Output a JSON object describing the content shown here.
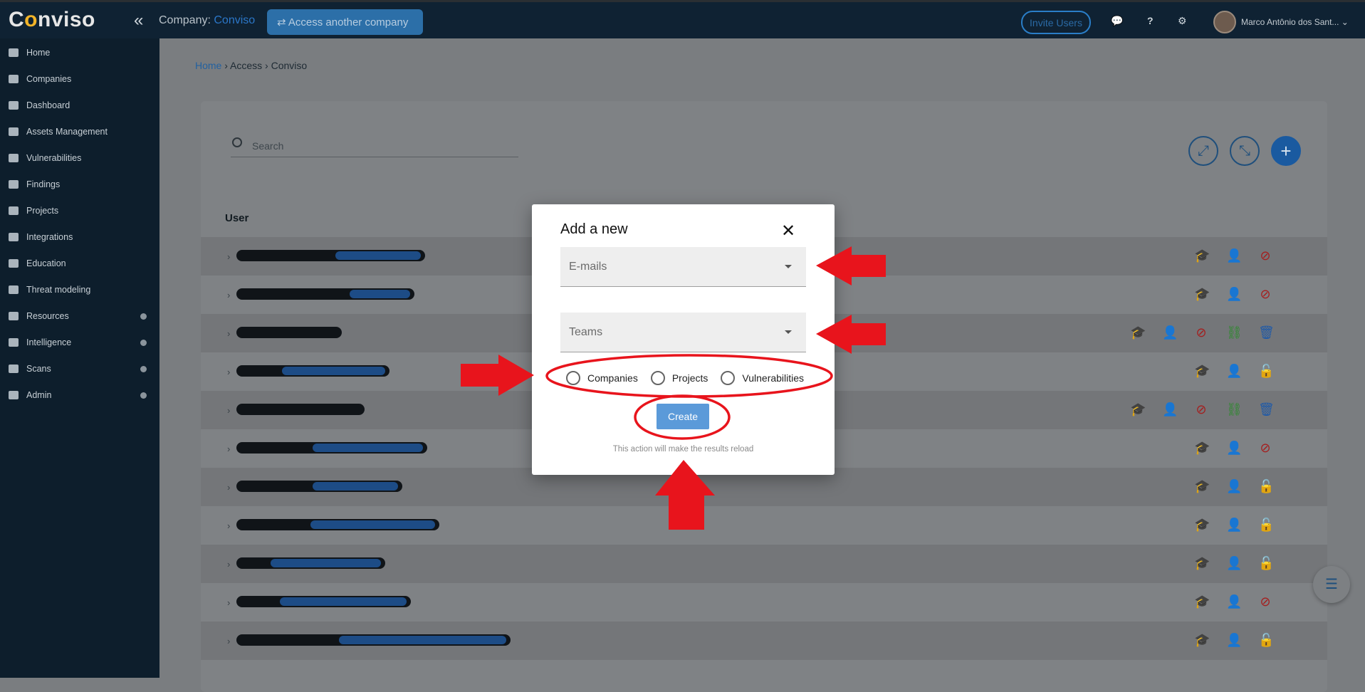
{
  "topbar": {
    "logo_pre": "C",
    "logo_o": "o",
    "logo_post": "nviso",
    "collapse_icon": "chevrons-left-icon",
    "company_prefix": "Company:",
    "company_name": "Conviso",
    "access_button": "⇄ Access another company",
    "invite_button": "Invite Users",
    "chat_icon": "chat-icon",
    "help_icon": "?",
    "settings_icon": "gear-icon",
    "user_name": "Marco Antônio dos Sant... ⌄"
  },
  "sidebar": {
    "items": [
      {
        "label": "Home",
        "icon": "home-icon"
      },
      {
        "label": "Companies",
        "icon": "building-icon"
      },
      {
        "label": "Dashboard",
        "icon": "gauge-icon"
      },
      {
        "label": "Assets Management",
        "icon": "server-icon"
      },
      {
        "label": "Vulnerabilities",
        "icon": "bug-icon"
      },
      {
        "label": "Findings",
        "icon": "flask-icon"
      },
      {
        "label": "Projects",
        "icon": "folder-icon"
      },
      {
        "label": "Integrations",
        "icon": "puzzle-icon"
      },
      {
        "label": "Education",
        "icon": "graduation-cap-icon"
      },
      {
        "label": "Threat modeling",
        "icon": "shield-icon"
      },
      {
        "label": "Resources",
        "icon": "wrench-icon",
        "has_submenu": true
      },
      {
        "label": "Intelligence",
        "icon": "lab-icon",
        "has_submenu": true
      },
      {
        "label": "Scans",
        "icon": "flask-icon",
        "has_submenu": true
      },
      {
        "label": "Admin",
        "icon": "briefcase-icon",
        "has_submenu": true
      }
    ]
  },
  "breadcrumb": {
    "home": "Home",
    "sep1": " › ",
    "access": "Access",
    "sep2": " › ",
    "current": "Conviso"
  },
  "search": {
    "placeholder": "Search"
  },
  "toolbar": {
    "expand_icon": "expand-icon",
    "collapse_icon": "compress-icon",
    "add_icon": "plus-icon"
  },
  "table": {
    "header": "User",
    "rows": [
      {
        "actions": [
          {
            "icon": "graduation-cap-icon",
            "color": "#a51e1e"
          },
          {
            "icon": "user-cog-icon",
            "color": "#2b8a2b"
          },
          {
            "icon": "ban-icon",
            "color": "#a51e1e"
          }
        ]
      },
      {
        "actions": [
          {
            "icon": "graduation-cap-icon",
            "color": "#a51e1e"
          },
          {
            "icon": "user-cog-icon",
            "color": "#2b8a2b"
          },
          {
            "icon": "ban-icon",
            "color": "#a51e1e"
          }
        ]
      },
      {
        "actions": [
          {
            "icon": "graduation-cap-icon",
            "color": "#1f5aa8"
          },
          {
            "icon": "user-cog-icon",
            "color": "#a51e1e"
          },
          {
            "icon": "ban-icon",
            "color": "#a51e1e"
          },
          {
            "icon": "link-icon",
            "color": "#2b8a2b"
          },
          {
            "icon": "trash-icon",
            "color": "#1f5aa8"
          }
        ]
      },
      {
        "actions": [
          {
            "icon": "graduation-cap-icon",
            "color": "#1f5aa8"
          },
          {
            "icon": "user-cog-icon",
            "color": "#2b8a2b"
          },
          {
            "icon": "lock-open-icon",
            "color": "#2b8a2b"
          }
        ]
      },
      {
        "actions": [
          {
            "icon": "graduation-cap-icon",
            "color": "#1f5aa8"
          },
          {
            "icon": "user-cog-icon",
            "color": "#a51e1e"
          },
          {
            "icon": "ban-icon",
            "color": "#a51e1e"
          },
          {
            "icon": "link-icon",
            "color": "#2b8a2b"
          },
          {
            "icon": "trash-icon",
            "color": "#1f5aa8"
          }
        ]
      },
      {
        "actions": [
          {
            "icon": "graduation-cap-icon",
            "color": "#a51e1e"
          },
          {
            "icon": "user-cog-icon",
            "color": "#2b8a2b"
          },
          {
            "icon": "ban-icon",
            "color": "#a51e1e"
          }
        ]
      },
      {
        "actions": [
          {
            "icon": "graduation-cap-icon",
            "color": "#1f5aa8"
          },
          {
            "icon": "user-cog-icon",
            "color": "#a51e1e"
          },
          {
            "icon": "lock-open-icon",
            "color": "#2b8a2b"
          }
        ]
      },
      {
        "actions": [
          {
            "icon": "graduation-cap-icon",
            "color": "#a51e1e"
          },
          {
            "icon": "user-cog-icon",
            "color": "#2b8a2b"
          },
          {
            "icon": "lock-open-icon",
            "color": "#2b8a2b"
          }
        ]
      },
      {
        "actions": [
          {
            "icon": "graduation-cap-icon",
            "color": "#1f5aa8"
          },
          {
            "icon": "user-cog-icon",
            "color": "#a51e1e"
          },
          {
            "icon": "lock-open-icon",
            "color": "#2b8a2b"
          }
        ]
      },
      {
        "actions": [
          {
            "icon": "graduation-cap-icon",
            "color": "#1f5aa8"
          },
          {
            "icon": "user-cog-icon",
            "color": "#2b8a2b"
          },
          {
            "icon": "ban-icon",
            "color": "#a51e1e"
          }
        ]
      },
      {
        "actions": [
          {
            "icon": "graduation-cap-icon",
            "color": "#a51e1e"
          },
          {
            "icon": "user-cog-icon",
            "color": "#2b8a2b"
          },
          {
            "icon": "lock-open-icon",
            "color": "#2b8a2b"
          }
        ]
      }
    ]
  },
  "modal": {
    "title": "Add a new",
    "close_icon": "close-icon",
    "emails_label": "E-mails",
    "teams_label": "Teams",
    "radios": [
      "Companies",
      "Projects",
      "Vulnerabilities"
    ],
    "create_label": "Create",
    "note": "This action will make the results reload"
  },
  "fab": {
    "icon": "list-icon"
  },
  "colors": {
    "annotation_red": "#e8141c",
    "accent_blue": "#1a5aa0"
  }
}
